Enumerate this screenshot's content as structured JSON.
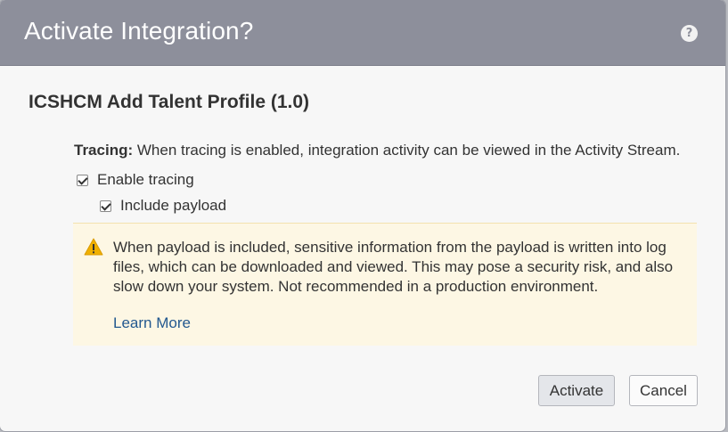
{
  "dialog": {
    "title": "Activate Integration?",
    "help_icon": "help-icon",
    "help_glyph": "?"
  },
  "integration": {
    "name": "ICSHCM Add Talent Profile (1.0)"
  },
  "tracing": {
    "label": "Tracing:",
    "description": "When tracing is enabled, integration activity can be viewed in the Activity Stream.",
    "enable_tracing": {
      "label": "Enable tracing",
      "checked": true
    },
    "include_payload": {
      "label": "Include payload",
      "checked": true
    }
  },
  "warning": {
    "icon": "warning-icon",
    "text": "When payload is included, sensitive information from the payload is written into log files, which can be downloaded and viewed. This may pose a security risk, and also slow down your system. Not recommended in a production environment.",
    "link_label": "Learn More"
  },
  "buttons": {
    "activate": "Activate",
    "cancel": "Cancel"
  },
  "colors": {
    "header": "#8d8f9b",
    "warning_bg": "#fdf7e4",
    "link": "#23598f",
    "warning_icon": "#f0b000"
  }
}
